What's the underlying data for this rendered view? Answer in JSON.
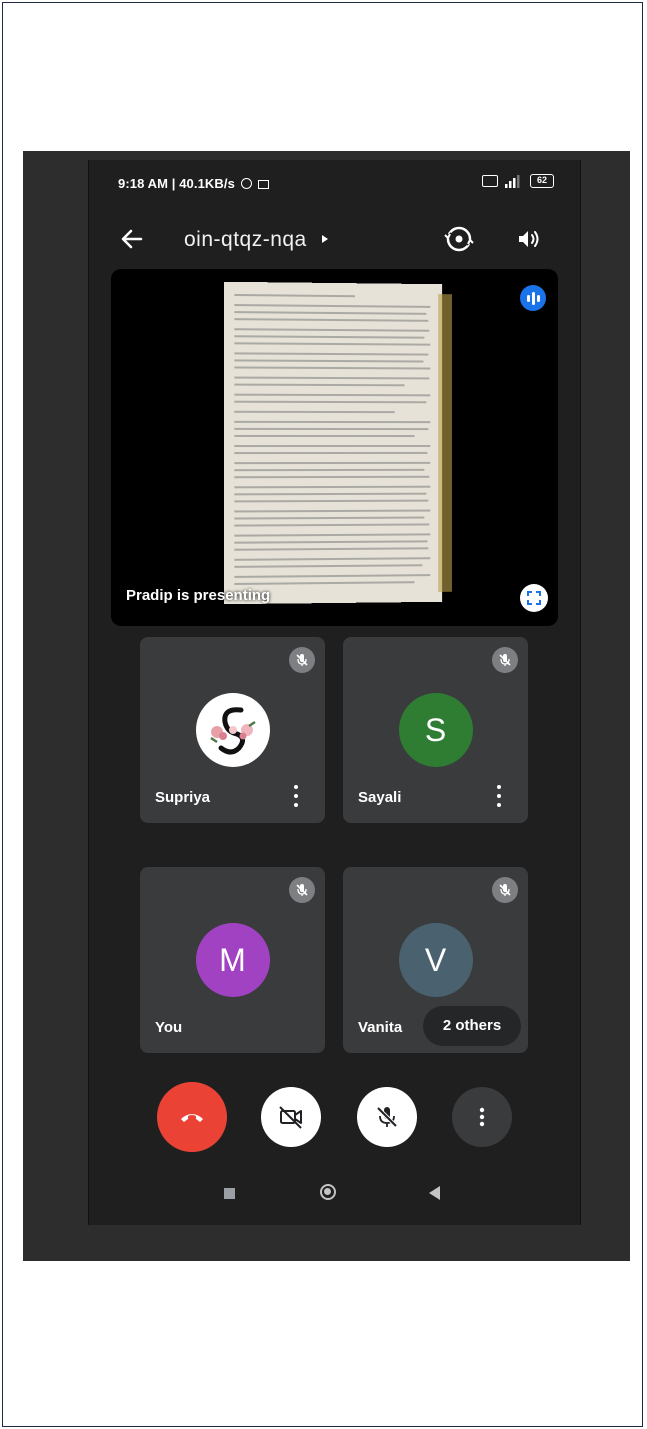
{
  "status_bar": {
    "left_text": "9:18 AM | 40.1KB/s",
    "battery_level": "62"
  },
  "top_bar": {
    "meeting_code": "oin-qtqz-nqa"
  },
  "presentation": {
    "presenting_label": "Pradip is presenting"
  },
  "participants": [
    {
      "name": "Supriya",
      "initial": "",
      "avatar_color": "#ffffff",
      "muted": true,
      "has_menu": true
    },
    {
      "name": "Sayali",
      "initial": "S",
      "avatar_color": "#2e7d32",
      "muted": true,
      "has_menu": true
    },
    {
      "name": "You",
      "initial": "M",
      "avatar_color": "#a142c2",
      "muted": true,
      "has_menu": false
    },
    {
      "name": "Vanita",
      "initial": "V",
      "avatar_color": "#4a6170",
      "muted": true,
      "has_menu": false
    }
  ],
  "others_chip": "2 others",
  "colors": {
    "hangup": "#ea4335",
    "voice_indicator": "#1a73e8",
    "tile_background": "#3a3b3d"
  },
  "controls": [
    "hang-up",
    "camera-off",
    "mic-off",
    "more-options"
  ],
  "nav": [
    "recents",
    "home",
    "back"
  ]
}
